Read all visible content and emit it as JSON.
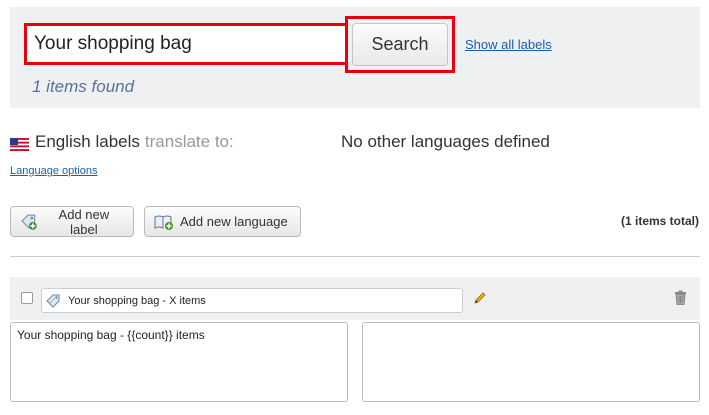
{
  "search": {
    "value": "Your shopping bag",
    "button_label": "Search",
    "show_all_link": "Show all labels",
    "results_text": "1 items found"
  },
  "languages": {
    "source_label": "English labels",
    "translate_to": "translate to:",
    "no_languages": "No other languages defined",
    "options_link": "Language options"
  },
  "toolbar": {
    "add_label": "Add new label",
    "add_language": "Add new language",
    "total_count": "(1 items total)"
  },
  "label_item": {
    "key_value": "Your shopping bag - X items",
    "english_text": "Your shopping bag - {{count}} items",
    "translation_text": ""
  },
  "colors": {
    "highlight": "#e8000d",
    "panel_bg": "#eef0f2",
    "link": "#1a5fb4",
    "results_text": "#5b7294"
  },
  "icons": [
    "us-flag-icon",
    "add-label-icon",
    "add-language-icon",
    "label-tag-icon",
    "pencil-edit-icon",
    "trash-icon"
  ]
}
